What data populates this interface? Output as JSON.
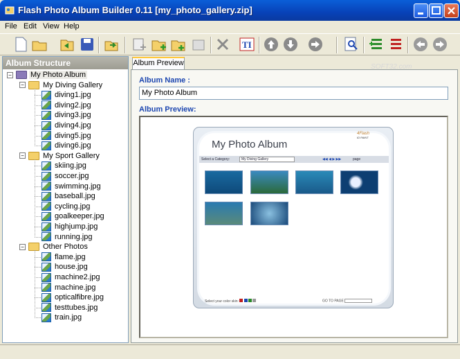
{
  "window": {
    "title": "Flash Photo Album Builder  0.11  [my_photo_gallery.zip]"
  },
  "menu": [
    "File",
    "Edit",
    "View",
    "Help"
  ],
  "toolbar": {
    "icons": [
      "new-icon",
      "open-icon",
      "folder-open-icon",
      "save-icon",
      "export-icon",
      "add-page-icon",
      "add-folder-icon",
      "add-image-icon",
      "insert-icon",
      "delete-icon",
      "text-icon",
      "move-up-icon",
      "move-down-icon",
      "forward-icon",
      "preview-zoom-icon",
      "add-item-icon",
      "remove-item-icon",
      "back-arrow-icon",
      "next-arrow-icon"
    ]
  },
  "left_panel": {
    "header": "Album Structure",
    "root": "My Photo Album",
    "groups": [
      {
        "name": "My Diving Gallery",
        "items": [
          "diving1.jpg",
          "diving2.jpg",
          "diving3.jpg",
          "diving4.jpg",
          "diving5.jpg",
          "diving6.jpg"
        ]
      },
      {
        "name": "My Sport Gallery",
        "items": [
          "skiing.jpg",
          "soccer.jpg",
          "swimming.jpg",
          "baseball.jpg",
          "cycling.jpg",
          "goalkeeper.jpg",
          "highjump.jpg",
          "running.jpg"
        ]
      },
      {
        "name": "Other Photos",
        "items": [
          "flame.jpg",
          "house.jpg",
          "machine2.jpg",
          "machine.jpg",
          "opticalfibre.jpg",
          "testtubes.jpg",
          "train.jpg"
        ]
      }
    ]
  },
  "right_panel": {
    "tab": "Album Preview",
    "album_name_label": "Album Name :",
    "album_name_value": "My Photo Album",
    "preview_label": "Album Preview:",
    "preview": {
      "title": "My Photo Album",
      "category_label": "Select a Category:",
      "category_value": "My Diving Gallery",
      "page_label": "page",
      "footer_left": "Select your color skin:",
      "footer_right": "GO TO PAGE",
      "logo": "4Flash",
      "logo_sub": "ID PAINT"
    }
  },
  "watermark": "SOFT32.com",
  "colors": {
    "titlebar": "#0842b8",
    "accent_label": "#1c46b0"
  }
}
